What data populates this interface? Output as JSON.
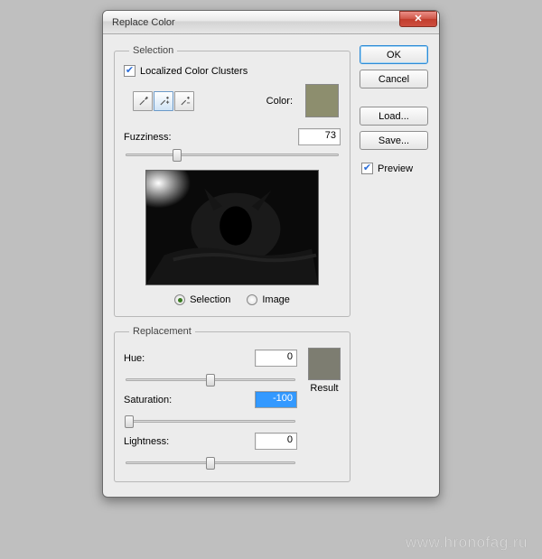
{
  "window": {
    "title": "Replace Color"
  },
  "selection": {
    "legend": "Selection",
    "localized_label": "Localized Color Clusters",
    "localized_checked": true,
    "color_label": "Color:",
    "swatch_hex": "#8d8e6e",
    "fuzziness_label": "Fuzziness:",
    "fuzziness_value": "73",
    "fuzziness_percent": 24,
    "mode_selection": "Selection",
    "mode_image": "Image",
    "mode_value": "selection"
  },
  "replacement": {
    "legend": "Replacement",
    "hue_label": "Hue:",
    "hue_value": "0",
    "hue_percent": 50,
    "saturation_label": "Saturation:",
    "saturation_value": "-100",
    "saturation_percent": 2,
    "lightness_label": "Lightness:",
    "lightness_value": "0",
    "lightness_percent": 50,
    "result_label": "Result",
    "result_hex": "#7d7d71"
  },
  "buttons": {
    "ok": "OK",
    "cancel": "Cancel",
    "load": "Load...",
    "save": "Save...",
    "preview": "Preview",
    "preview_checked": true
  },
  "watermark": "www.hronofag.ru"
}
